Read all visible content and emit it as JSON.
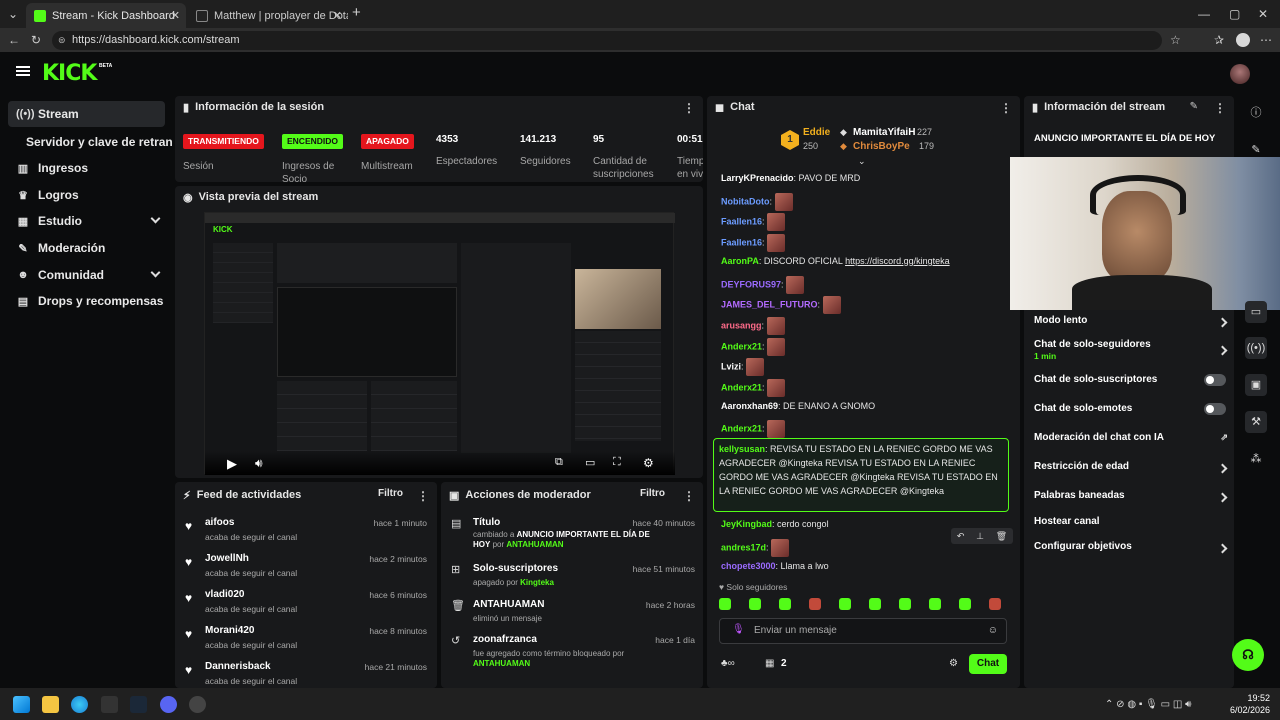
{
  "browser": {
    "tabs": [
      {
        "title": "Stream - Kick Dashboard",
        "active": true
      },
      {
        "title": "Matthew | proplayer de DotaHoy",
        "active": false
      }
    ],
    "url": "https://dashboard.kick.com/stream"
  },
  "header": {
    "logo": "KICK",
    "logo_tag": "BETA"
  },
  "sidebar": {
    "items": [
      {
        "label": "Stream",
        "icon": "stream-icon"
      },
      {
        "label": "Servidor y clave de retransmisión",
        "icon": ""
      },
      {
        "label": "Ingresos",
        "icon": "chart-icon"
      },
      {
        "label": "Logros",
        "icon": "trophy-icon"
      },
      {
        "label": "Estudio",
        "icon": "studio-icon"
      },
      {
        "label": "Moderación",
        "icon": "wrench-icon"
      },
      {
        "label": "Comunidad",
        "icon": "community-icon"
      },
      {
        "label": "Drops y recompensas",
        "icon": "drops-icon"
      }
    ]
  },
  "session": {
    "title": "Información de la sesión",
    "stats": [
      {
        "value": "TRANSMITIENDO",
        "label": "Sesión",
        "badge": true,
        "color": "#e5161d"
      },
      {
        "value": "ENCENDIDO",
        "label": "Ingresos de Socio",
        "badge": true,
        "color": "#53fc18"
      },
      {
        "value": "APAGADO",
        "label": "Multistream",
        "badge": true,
        "color": "#e5161d"
      },
      {
        "value": "4353",
        "label": "Espectadores"
      },
      {
        "value": "141.213",
        "label": "Seguidores"
      },
      {
        "value": "95",
        "label": "Cantidad de suscripciones"
      },
      {
        "value": "00:51",
        "label": "Tiempo en vivo"
      }
    ]
  },
  "preview": {
    "title": "Vista previa del stream"
  },
  "activity": {
    "title": "Feed de actividades",
    "filter": "Filtro",
    "items": [
      {
        "name": "aifoos",
        "sub": "acaba de seguir el canal",
        "time": "hace 1 minuto"
      },
      {
        "name": "JowellNh",
        "sub": "acaba de seguir el canal",
        "time": "hace 2 minutos"
      },
      {
        "name": "vladi020",
        "sub": "acaba de seguir el canal",
        "time": "hace 6 minutos"
      },
      {
        "name": "Morani420",
        "sub": "acaba de seguir el canal",
        "time": "hace 8 minutos"
      },
      {
        "name": "Dannerisback",
        "sub": "acaba de seguir el canal",
        "time": "hace 21 minutos"
      }
    ]
  },
  "modactions": {
    "title": "Acciones de moderador",
    "filter": "Filtro",
    "items": [
      {
        "title": "Título",
        "sub_pre": "cambiado a ",
        "sub_bold": "ANUNCIO IMPORTANTE EL DÍA DE HOY",
        "sub_post": " por ",
        "user": "ANTAHUAMAN",
        "time": "hace 40 minutos"
      },
      {
        "title": "Solo-suscriptores",
        "sub_pre": "apagado por ",
        "sub_bold": "",
        "sub_post": "",
        "user": "Kingteka",
        "time": "hace 51 minutos"
      },
      {
        "title": "ANTAHUAMAN",
        "sub_pre": "eliminó un mensaje",
        "sub_bold": "",
        "sub_post": "",
        "user": "",
        "time": "hace 2 horas"
      },
      {
        "title": "zoonafrzanca",
        "sub_pre": "fue agregado como término bloqueado por",
        "sub_bold": "",
        "sub_post": "",
        "user": "ANTAHUAMAN",
        "time": "hace 1 día"
      }
    ]
  },
  "chat": {
    "title": "Chat",
    "top": [
      {
        "name": "Eddie",
        "count": "250",
        "rank": "1"
      },
      {
        "name": "MamitaYifaiH",
        "count": "227"
      },
      {
        "name": "ChrisBoyPe",
        "count": "179"
      }
    ],
    "messages": [
      {
        "user": "LarryKPrenacido",
        "color": "#ffffff",
        "text": "PAVO DE MRD",
        "emote": false
      },
      {
        "user": "NobitaDoto",
        "color": "#6c9cff",
        "text": "",
        "emote": true
      },
      {
        "user": "Faallen16",
        "color": "#6c9cff",
        "text": "",
        "emote": true
      },
      {
        "user": "Faallen16",
        "color": "#6c9cff",
        "text": "",
        "emote": true
      },
      {
        "user": "AaronPA",
        "color": "#53fc18",
        "text": "DISCORD OFICIAL",
        "link": "https://discord.gg/kingteka",
        "emote": false
      },
      {
        "user": "DEYFORUS97",
        "color": "#9b6bff",
        "text": "",
        "emote": true
      },
      {
        "user": "JAMES_DEL_FUTURO",
        "color": "#b36bff",
        "text": "",
        "emote": true
      },
      {
        "user": "arusangg",
        "color": "#ff6b8a",
        "text": "",
        "emote": true
      },
      {
        "user": "Anderx21",
        "color": "#53fc18",
        "text": "",
        "emote": true
      },
      {
        "user": "Lvizi",
        "color": "#ffffff",
        "text": "",
        "emote": true
      },
      {
        "user": "Anderx21",
        "color": "#53fc18",
        "text": "",
        "emote": true
      },
      {
        "user": "Aaronxhan69",
        "color": "#ffffff",
        "text": "DE ENANO A GNOMO",
        "emote": false
      },
      {
        "user": "Anderx21",
        "color": "#53fc18",
        "text": "",
        "emote": true
      }
    ],
    "highlight": {
      "user": "kellysusan",
      "text": "REVISA TU ESTADO EN LA RENIEC GORDO ME VAS AGRADECER @Kingteka REVISA TU ESTADO EN LA RENIEC GORDO ME VAS AGRADECER @Kingteka REVISA TU ESTADO EN LA RENIEC GORDO ME VAS AGRADECER @Kingteka"
    },
    "after": [
      {
        "user": "JeyKingbad",
        "color": "#53fc18",
        "text": "cerdo congol",
        "emote": false
      },
      {
        "user": "andres17d",
        "color": "#53fc18",
        "text": "",
        "emote": true
      },
      {
        "user": "chopete3000",
        "color": "#9b6bff",
        "text": "Llama a lwo",
        "emote": false
      }
    ],
    "followers_only": "Solo seguidores",
    "input_placeholder": "Enviar un mensaje",
    "points": "2",
    "send": "Chat"
  },
  "stream_info": {
    "title": "Información del stream",
    "announcement": "ANUNCIO IMPORTANTE EL DÍA DE HOY",
    "settings": [
      {
        "label": "Modo lento",
        "sub": "",
        "type": "arrow"
      },
      {
        "label": "Chat de solo-seguidores",
        "sub": "1 min",
        "type": "arrow"
      },
      {
        "label": "Chat de solo-suscriptores",
        "sub": "",
        "type": "toggle"
      },
      {
        "label": "Chat de solo-emotes",
        "sub": "",
        "type": "toggle"
      },
      {
        "label": "Moderación del chat con IA",
        "sub": "",
        "type": "external"
      },
      {
        "label": "Restricción de edad",
        "sub": "",
        "type": "arrow"
      },
      {
        "label": "Palabras baneadas",
        "sub": "",
        "type": "arrow"
      },
      {
        "label": "Hostear canal",
        "sub": "",
        "type": "none"
      },
      {
        "label": "Configurar objetivos",
        "sub": "",
        "type": "arrow"
      }
    ]
  },
  "taskbar": {
    "time": "19:52",
    "date": "6/02/2026"
  },
  "colors": {
    "kick_green": "#53fc18",
    "live_red": "#e5161d",
    "panel": "#18191b",
    "bg": "#0b0c0d"
  }
}
